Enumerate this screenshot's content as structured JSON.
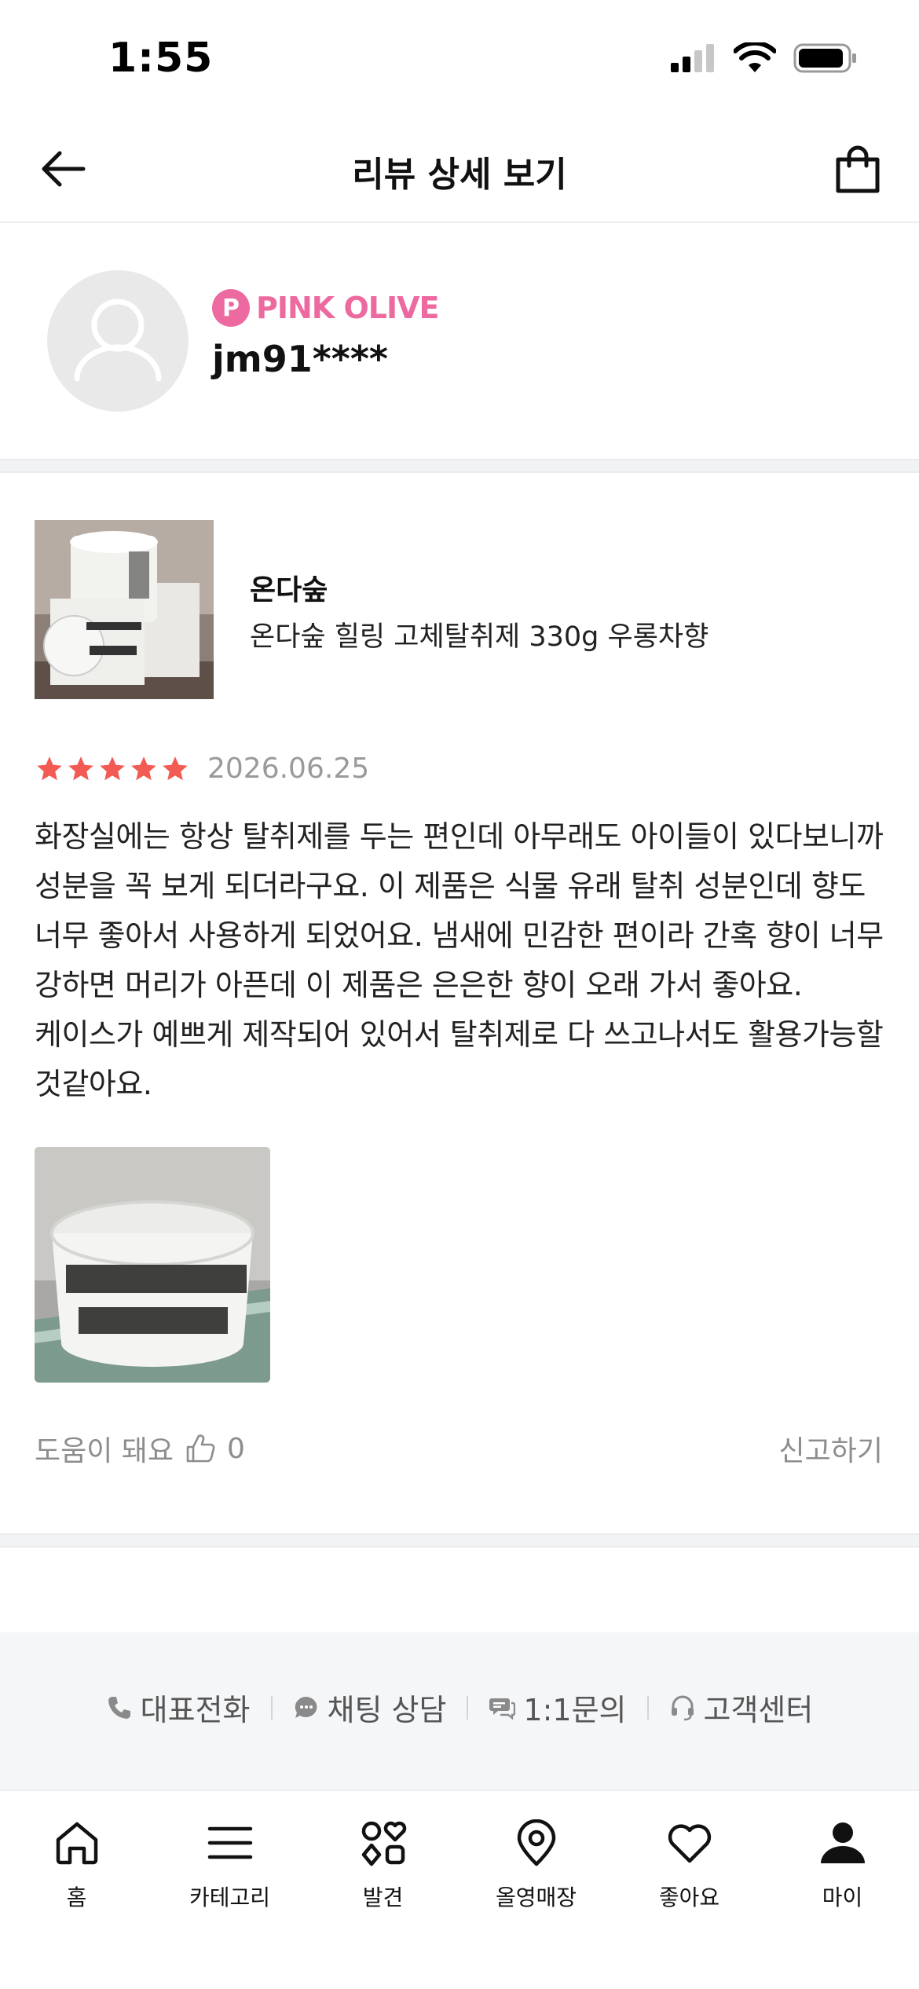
{
  "status_bar": {
    "time": "1:55"
  },
  "header": {
    "title": "리뷰 상세 보기"
  },
  "reviewer": {
    "grade_initial": "P",
    "grade": "PINK OLIVE",
    "username": "jm91****"
  },
  "product": {
    "brand": "온다숲",
    "name": "온다숲 힐링 고체탈취제 330g 우롱차향"
  },
  "review": {
    "rating": 5,
    "date": "2026.06.25",
    "text": "화장실에는 항상 탈취제를 두는 편인데 아무래도 아이들이 있다보니까 성분을 꼭 보게 되더라구요. 이 제품은 식물 유래 탈취 성분인데 향도 너무 좋아서 사용하게 되었어요. 냄새에 민감한 편이라 간혹 향이 너무 강하면 머리가 아픈데 이 제품은 은은한 향이 오래 가서 좋아요. 케이스가 예쁘게 제작되어 있어서 탈취제로 다 쓰고나서도 활용가능할 것같아요.",
    "helpful_label": "도움이 돼요",
    "helpful_count": "0",
    "report_label": "신고하기"
  },
  "contact": {
    "phone": "대표전화",
    "chat": "채팅 상담",
    "inquiry": "1:1문의",
    "service": "고객센터"
  },
  "bottom_nav": {
    "home": "홈",
    "category": "카테고리",
    "discover": "발견",
    "store": "올영매장",
    "likes": "좋아요",
    "my": "마이"
  },
  "colors": {
    "grade_pink": "#ec6aa0",
    "star_red": "#f25a54",
    "muted_text": "#8d8d8d",
    "band_bg": "#f5f6f8"
  }
}
